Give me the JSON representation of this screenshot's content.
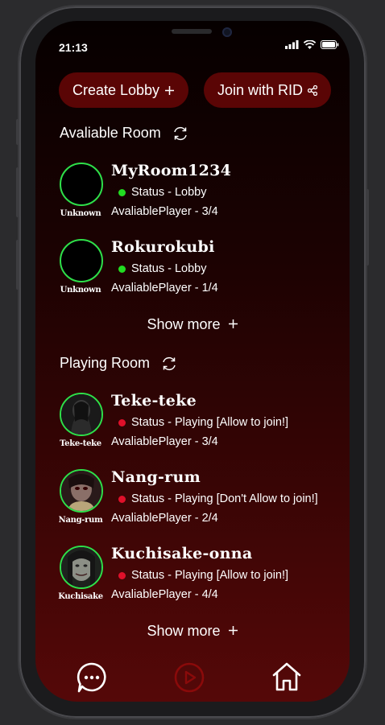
{
  "status_bar": {
    "time": "21:13"
  },
  "actions": {
    "create_lobby": "Create Lobby",
    "join_with_rid": "Join with RID"
  },
  "available": {
    "title": "Avaliable Room",
    "rooms": [
      {
        "name": "MyRoom1234",
        "status": "Status - Lobby",
        "players": "AvaliablePlayer - 3/4",
        "caption": "Unknown"
      },
      {
        "name": "Rokurokubi",
        "status": "Status - Lobby",
        "players": "AvaliablePlayer - 1/4",
        "caption": "Unknown"
      }
    ],
    "show_more": "Show more"
  },
  "playing": {
    "title": "Playing Room",
    "rooms": [
      {
        "name": "Teke-teke",
        "status": "Status - Playing [Allow to join!]",
        "players": "AvaliablePlayer - 3/4",
        "caption": "Teke-teke"
      },
      {
        "name": "Nang-rum",
        "status": "Status - Playing [Don't Allow to join!]",
        "players": "AvaliablePlayer - 2/4",
        "caption": "Nang-rum"
      },
      {
        "name": "Kuchisake-onna",
        "status": "Status - Playing [Allow to join!]",
        "players": "AvaliablePlayer - 4/4",
        "caption": "Kuchisake"
      }
    ],
    "show_more": "Show more"
  },
  "nav": [
    "chat-icon",
    "play-icon",
    "home-icon"
  ],
  "colors": {
    "lobby_dot": "#22dd22",
    "playing_dot": "#e0102a",
    "avatar_ring": "#2ee04a",
    "pill_bg": "#5a0505",
    "play_icon": "#8a0a0a"
  }
}
